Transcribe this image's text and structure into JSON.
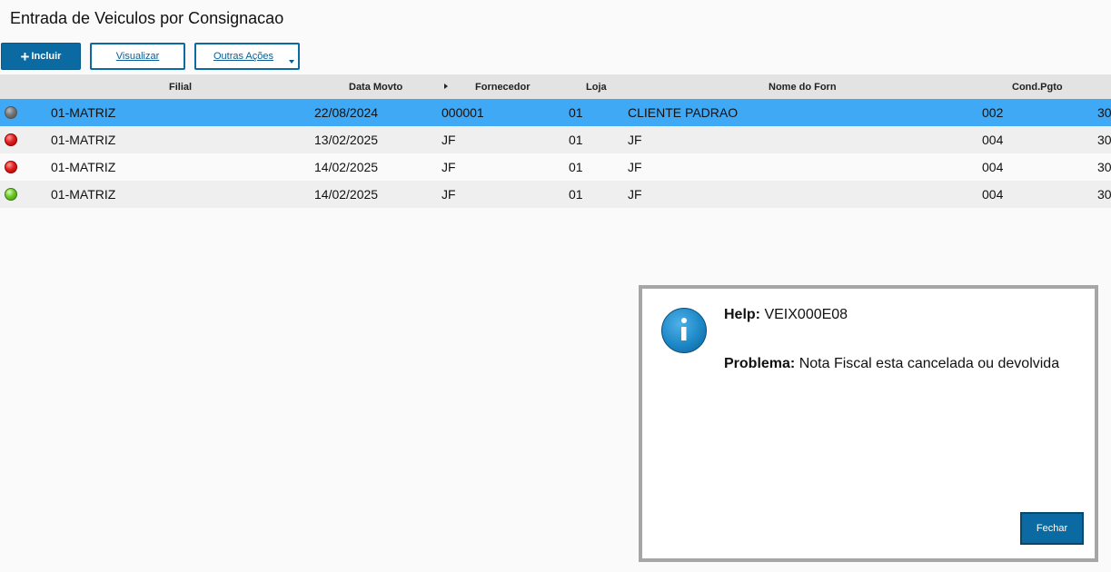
{
  "page": {
    "title": "Entrada de Veiculos por Consignacao"
  },
  "toolbar": {
    "include_icon": "+",
    "include_label": "Incluir",
    "view_label": "Visualizar",
    "other_actions_label": "Outras Ações"
  },
  "grid": {
    "columns": {
      "filial": "Filial",
      "data_movto": "Data Movto",
      "fornecedor": "Fornecedor",
      "loja": "Loja",
      "nome_forn": "Nome do Forn",
      "cond_pgto": "Cond.Pgto"
    },
    "rows": [
      {
        "status": "gray",
        "filial": "01-MATRIZ",
        "data": "22/08/2024",
        "fornecedor": "000001",
        "loja": "01",
        "nome": "CLIENTE PADRAO",
        "cond": "002",
        "extra": "30"
      },
      {
        "status": "red",
        "filial": "01-MATRIZ",
        "data": "13/02/2025",
        "fornecedor": "JF",
        "loja": "01",
        "nome": "JF",
        "cond": "004",
        "extra": "30"
      },
      {
        "status": "red",
        "filial": "01-MATRIZ",
        "data": "14/02/2025",
        "fornecedor": "JF",
        "loja": "01",
        "nome": "JF",
        "cond": "004",
        "extra": "30"
      },
      {
        "status": "green",
        "filial": "01-MATRIZ",
        "data": "14/02/2025",
        "fornecedor": "JF",
        "loja": "01",
        "nome": "JF",
        "cond": "004",
        "extra": "30"
      }
    ]
  },
  "dialog": {
    "icon": "info-icon",
    "help_label": "Help:",
    "help_value": "VEIX000E08",
    "problem_label": "Problema:",
    "problem_value": "Nota Fiscal esta cancelada ou devolvida",
    "close_label": "Fechar"
  }
}
